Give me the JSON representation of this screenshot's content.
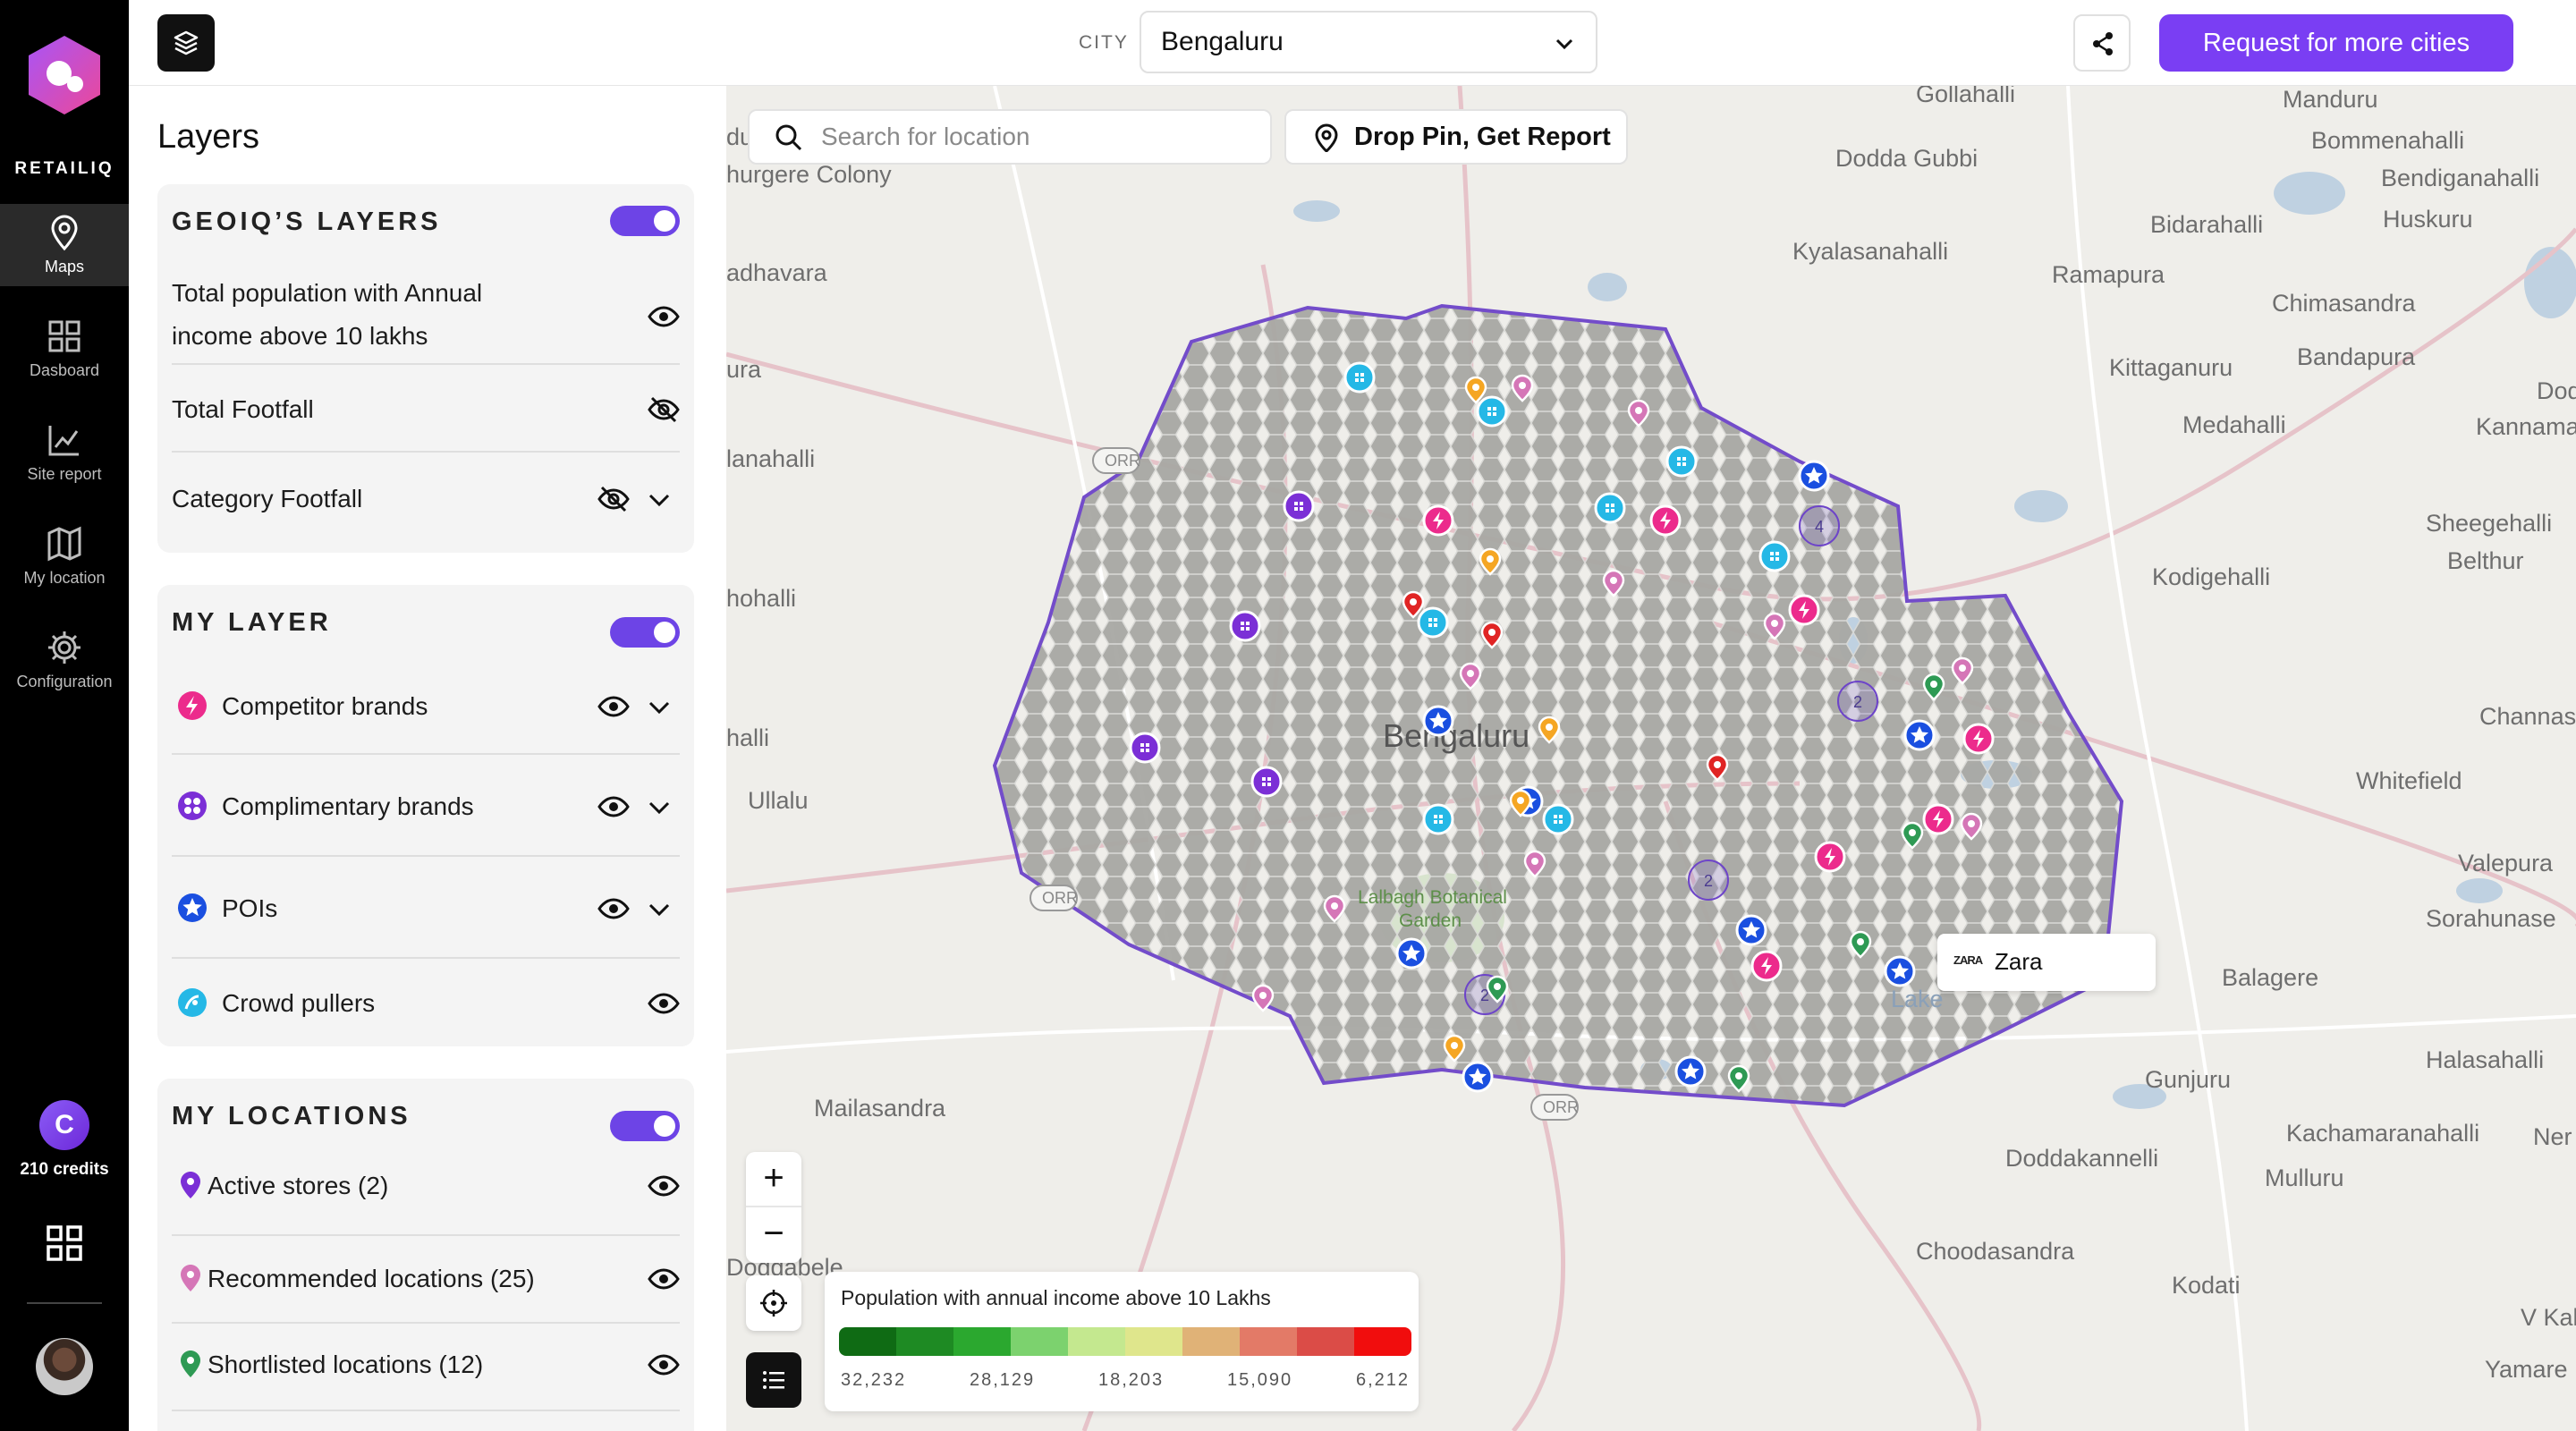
{
  "app": {
    "brand": "RETAILIQ",
    "nav": [
      {
        "label": "Maps",
        "icon": "map-pin-icon",
        "active": true
      },
      {
        "label": "Dasboard",
        "icon": "grid-icon",
        "active": false
      },
      {
        "label": "Site report",
        "icon": "chart-line-icon",
        "active": false
      },
      {
        "label": "My location",
        "icon": "map-fold-icon",
        "active": false
      },
      {
        "label": "Configuration",
        "icon": "gear-icon",
        "active": false
      }
    ],
    "credit_initial": "C",
    "credits": "210 credits"
  },
  "topbar": {
    "city_label": "CITY",
    "city_value": "Bengaluru",
    "request_label": "Request for more cities"
  },
  "layers": {
    "title": "Layers",
    "geoiq": {
      "heading": "GEOIQ’S LAYERS",
      "enabled": true,
      "items": [
        {
          "label_line1": "Total population with Annual",
          "label_line2": "income above 10 lakhs",
          "visible": true
        },
        {
          "label": "Total Footfall",
          "visible": false
        },
        {
          "label": "Category Footfall",
          "visible": false
        }
      ]
    },
    "my_layer": {
      "heading": "MY LAYER",
      "enabled": true,
      "items": [
        {
          "label": "Competitor brands",
          "icon": "lightning-icon",
          "color": "#ec2b8c"
        },
        {
          "label": "Complimentary brands",
          "icon": "flower-icon",
          "color": "#7b2fd6"
        },
        {
          "label": "POIs",
          "icon": "star-icon",
          "color": "#1a4fe0"
        },
        {
          "label": "Crowd pullers",
          "icon": "crowd-icon",
          "color": "#25b8e6"
        }
      ]
    },
    "my_locations": {
      "heading": "MY LOCATIONS",
      "enabled": true,
      "items": [
        {
          "label": "Active stores (2)",
          "color": "#7b2fd6"
        },
        {
          "label": "Recommended locations (25)",
          "color": "#d576b7"
        },
        {
          "label": "Shortlisted locations (12)",
          "color": "#2e9a54"
        }
      ]
    }
  },
  "map": {
    "search_placeholder": "Search for location",
    "drop_pin_label": "Drop Pin, Get Report",
    "city_center_label": "Bengaluru",
    "park_label_1": "Lalbagh Botanical",
    "park_label_2": "Garden",
    "lake_label": "Lake",
    "place_labels": [
      "Gollahalli",
      "Manduru",
      "Dodda Gubbi",
      "Bommenahalli",
      "Bendiganahalli",
      "hurgere Colony",
      "Bidarahalli",
      "Huskuru",
      "adhavara",
      "Kyalasanahalli",
      "Ramapura",
      "Chimasandra",
      "Bandapura",
      "Kittaganuru",
      "Dodd",
      "Medahalli",
      "Kannamang",
      "ura",
      "lanahalli",
      "Sheegehalli",
      "Belthur",
      "Kodigehalli",
      "hohalli",
      "Channasand",
      "halli",
      "Ullalu",
      "Whitefield",
      "Valepura",
      "Sorahunase",
      "Balagere",
      "Halasahalli",
      "Gunjuru",
      "Mailasandra",
      "Kachamaranahalli",
      "Ner",
      "Doddakannelli",
      "Mulluru",
      "Doddabele",
      "Choodasandra",
      "Kodati",
      "V Kalla",
      "Yamare",
      "du"
    ],
    "road_badges": [
      "ORR",
      "ORR",
      "ORR"
    ],
    "cluster_counts": [
      "4",
      "2",
      "2",
      "2"
    ],
    "tooltip": {
      "logo": "ZARA",
      "name": "Zara"
    },
    "legend": {
      "title": "Population with annual income above 10 Lakhs",
      "colors": [
        "#0f6b14",
        "#1e8a23",
        "#2ba82f",
        "#7cd26e",
        "#c4e88f",
        "#dfe68c",
        "#e0b277",
        "#e37a67",
        "#db4c47",
        "#f10d0d"
      ],
      "ticks": [
        "32,232",
        "28,129",
        "18,203",
        "15,090",
        "6,212"
      ]
    },
    "zoom_in": "+",
    "zoom_out": "−"
  }
}
